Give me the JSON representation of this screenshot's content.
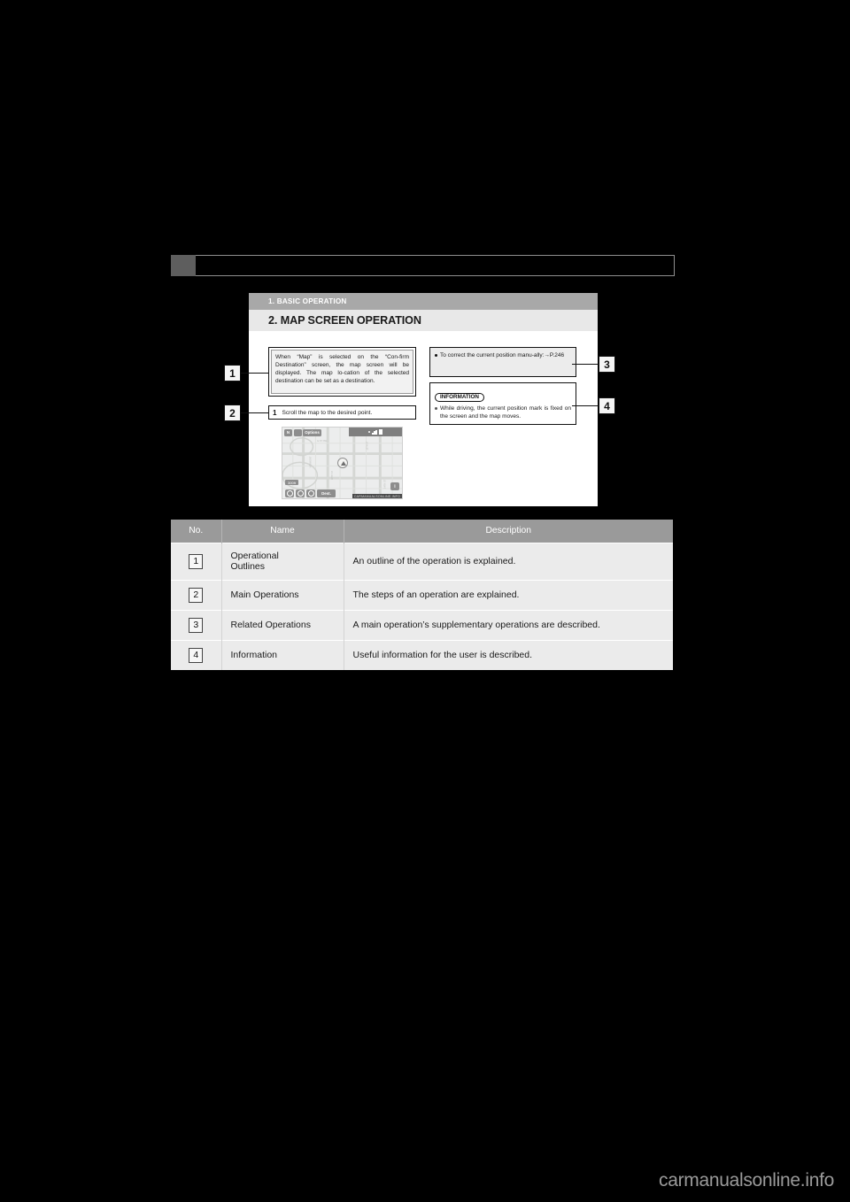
{
  "page": {
    "background_color": "#000000",
    "watermark": "carmanualsonline.info"
  },
  "chapter_bar": {
    "tab_color": "#5e5e5e",
    "strip_border_color": "#8f8f8f"
  },
  "figure": {
    "section_label": "1. BASIC OPERATION",
    "section_title": "2. MAP SCREEN OPERATION",
    "operational_outline": "When “Map” is selected on the “Con-firm Destination” screen, the map screen will be displayed. The map lo-cation of the selected destination can be set as a destination.",
    "main_operation": {
      "step_number": "1",
      "step_text": "Scroll the map to the desired point."
    },
    "related_operation": "To correct the current position manu-ally:→P.246",
    "information": {
      "heading": "INFORMATION",
      "text": "While driving, the current position mark is fixed on the screen and the map moves."
    },
    "callouts": [
      {
        "id": "1",
        "label": "1"
      },
      {
        "id": "2",
        "label": "2"
      },
      {
        "id": "3",
        "label": "3"
      },
      {
        "id": "4",
        "label": "4"
      }
    ],
    "map_screen": {
      "compass_label": "N",
      "options_label": "Options",
      "zoom_label": "300ft",
      "destination_label": "Dest.",
      "help_label": "i",
      "footer_label": "CARMANUALSONLINE.INFO"
    }
  },
  "legend": {
    "headers": [
      "No.",
      "Name",
      "Description"
    ],
    "rows": [
      {
        "no": "1",
        "name": "Operational\nOutlines",
        "name_line1": "Operational",
        "name_line2": "Outlines",
        "description": "An outline of the operation is explained."
      },
      {
        "no": "2",
        "name": "Main Operations",
        "description": "The steps of an operation are explained."
      },
      {
        "no": "3",
        "name": "Related Operations",
        "description": "A main operation’s supplementary operations are described."
      },
      {
        "no": "4",
        "name": "Information",
        "description": "Useful information for the user is described."
      }
    ]
  }
}
